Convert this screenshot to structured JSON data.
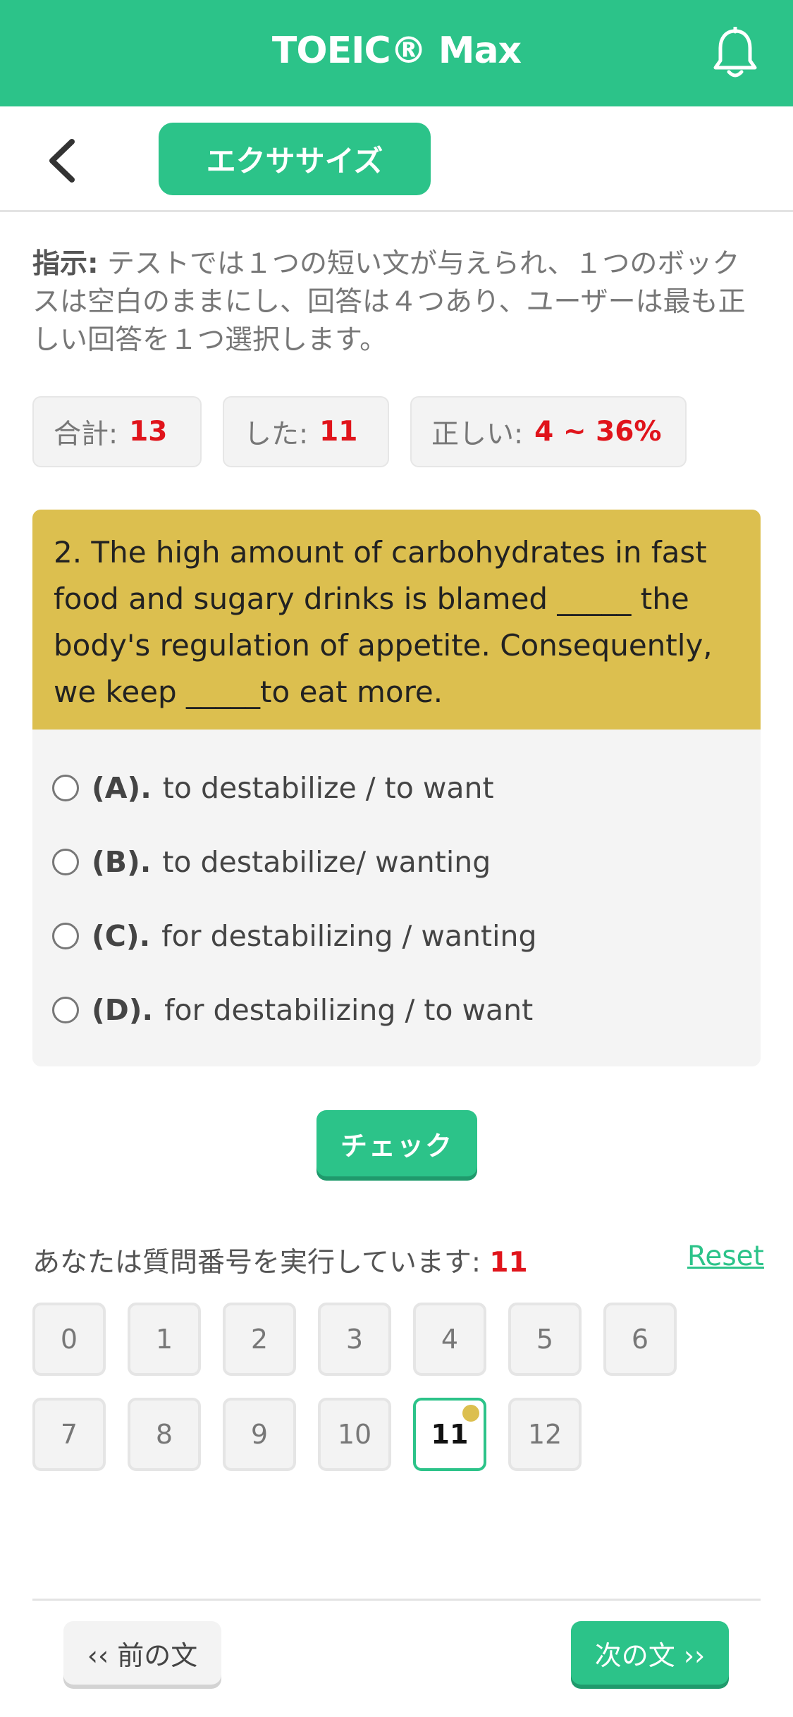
{
  "header": {
    "title": "TOEIC® Max",
    "bell_icon": "bell-icon"
  },
  "toolbar": {
    "back_icon": "chevron-left-icon",
    "tab_label": "エクササイズ"
  },
  "instruction": {
    "label": "指示:",
    "text": " テストでは１つの短い文が与えられ、１つのボックスは空白のままにし、回答は４つあり、ユーザーは最も正しい回答を１つ選択します。"
  },
  "stats": [
    {
      "label": "合計:",
      "value": "13"
    },
    {
      "label": "した:",
      "value": "11"
    },
    {
      "label": "正しい:",
      "value": "4 ~ 36%"
    }
  ],
  "question": {
    "text": "2. The high amount of carbohydrates in fast food and sugary drinks is blamed _____ the body's regulation of appetite. Consequently, we keep _____to eat more."
  },
  "options": [
    {
      "letter": "(A).",
      "text": "to destabilize / to want"
    },
    {
      "letter": "(B).",
      "text": "to destabilize/ wanting"
    },
    {
      "letter": "(C).",
      "text": "for destabilizing / wanting"
    },
    {
      "letter": "(D).",
      "text": "for destabilizing / to want"
    }
  ],
  "check_label": "チェック",
  "progress": {
    "label": "あなたは質問番号を実行しています:",
    "current": "11",
    "reset_label": "Reset"
  },
  "question_numbers": [
    "0",
    "1",
    "2",
    "3",
    "4",
    "5",
    "6",
    "7",
    "8",
    "9",
    "10",
    "11",
    "12"
  ],
  "footer": {
    "prev_label": "‹‹ 前の文",
    "next_label": "次の文 ››"
  },
  "colors": {
    "accent": "#2cc389",
    "question_bg": "#dcbf4f",
    "highlight": "#e0141b"
  }
}
